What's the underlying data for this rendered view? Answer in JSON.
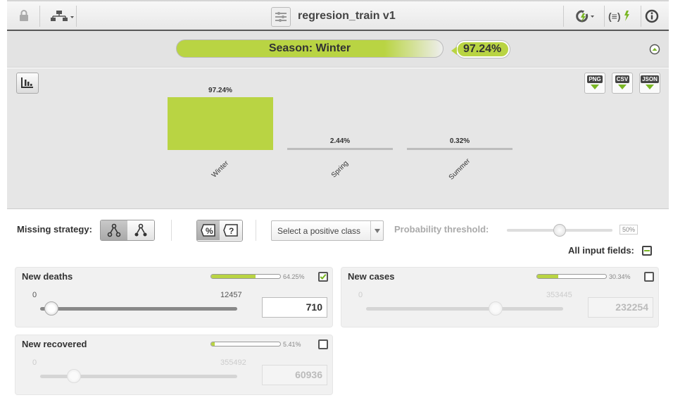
{
  "header": {
    "title": "regresion_train v1",
    "lock_icon": "lock-icon",
    "tree_icon": "tree-structure-icon",
    "refresh_icon": "refresh-lightning-icon",
    "formula_icon": "formula-lightning-icon",
    "info_icon": "info-icon"
  },
  "prediction": {
    "label": "Season: Winter",
    "confidence": "97.24%"
  },
  "chart_data": {
    "type": "bar",
    "categories": [
      "Winter",
      "Spring",
      "Summer"
    ],
    "values": [
      97.24,
      2.44,
      0.32
    ],
    "value_labels": [
      "97.24%",
      "2.44%",
      "0.32%"
    ],
    "bar_color": "#b9d443",
    "ylim": [
      0,
      100
    ],
    "grid": false
  },
  "downloads": {
    "png": "PNG",
    "csv": "CSV",
    "json": "JSON"
  },
  "controls": {
    "missing_strategy_label": "Missing strategy:",
    "positive_class_placeholder": "Select a positive class",
    "probability_threshold_label": "Probability threshold:",
    "threshold_value": "50%",
    "threshold": 0.5,
    "all_input_fields_label": "All input fields:"
  },
  "fields": [
    {
      "name": "New deaths",
      "importance_pct": "64.25%",
      "importance": 0.6425,
      "min": "0",
      "max": "12457",
      "value": "710",
      "slider": 0.057,
      "checked": true
    },
    {
      "name": "New cases",
      "importance_pct": "30.34%",
      "importance": 0.3034,
      "min": "0",
      "max": "353445",
      "value": "232254",
      "slider": 0.657,
      "checked": false
    },
    {
      "name": "New recovered",
      "importance_pct": "5.41%",
      "importance": 0.0541,
      "min": "0",
      "max": "355492",
      "value": "60936",
      "slider": 0.171,
      "checked": false
    }
  ],
  "colors": {
    "accent": "#b9d443",
    "header_border": "#585858"
  }
}
